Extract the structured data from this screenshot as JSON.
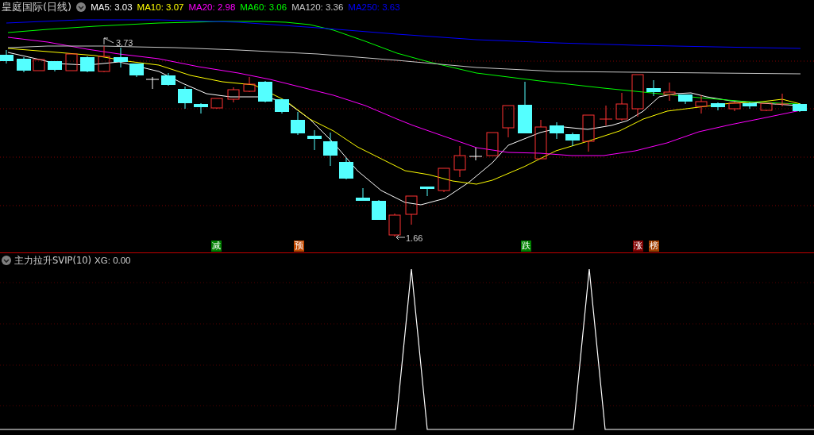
{
  "chart": {
    "title": "皇庭国际(日线)",
    "ma_legend": [
      {
        "label": "MA5:",
        "value": "3.03",
        "color": "#ffffff"
      },
      {
        "label": "MA10:",
        "value": "3.07",
        "color": "#ffff00"
      },
      {
        "label": "MA20:",
        "value": "2.98",
        "color": "#ff00ff"
      },
      {
        "label": "MA60:",
        "value": "3.06",
        "color": "#00ff00"
      },
      {
        "label": "MA120:",
        "value": "3.36",
        "color": "#c8c8c8"
      },
      {
        "label": "MA250:",
        "value": "3.63",
        "color": "#0000ff"
      }
    ],
    "annotations": [
      {
        "kind": "high",
        "text": "3.73"
      },
      {
        "kind": "low",
        "text": "1.66"
      }
    ],
    "markers": [
      {
        "text": "减",
        "color": "#008000"
      },
      {
        "text": "预",
        "color": "#c04800"
      },
      {
        "text": "跌",
        "color": "#008000"
      },
      {
        "text": "涨",
        "color": "#800000"
      },
      {
        "text": "榜",
        "color": "#a04000"
      }
    ]
  },
  "indicator": {
    "title": "主力拉升SVIP(10)",
    "readings": [
      {
        "label": "XG:",
        "value": "0.00"
      }
    ]
  }
}
